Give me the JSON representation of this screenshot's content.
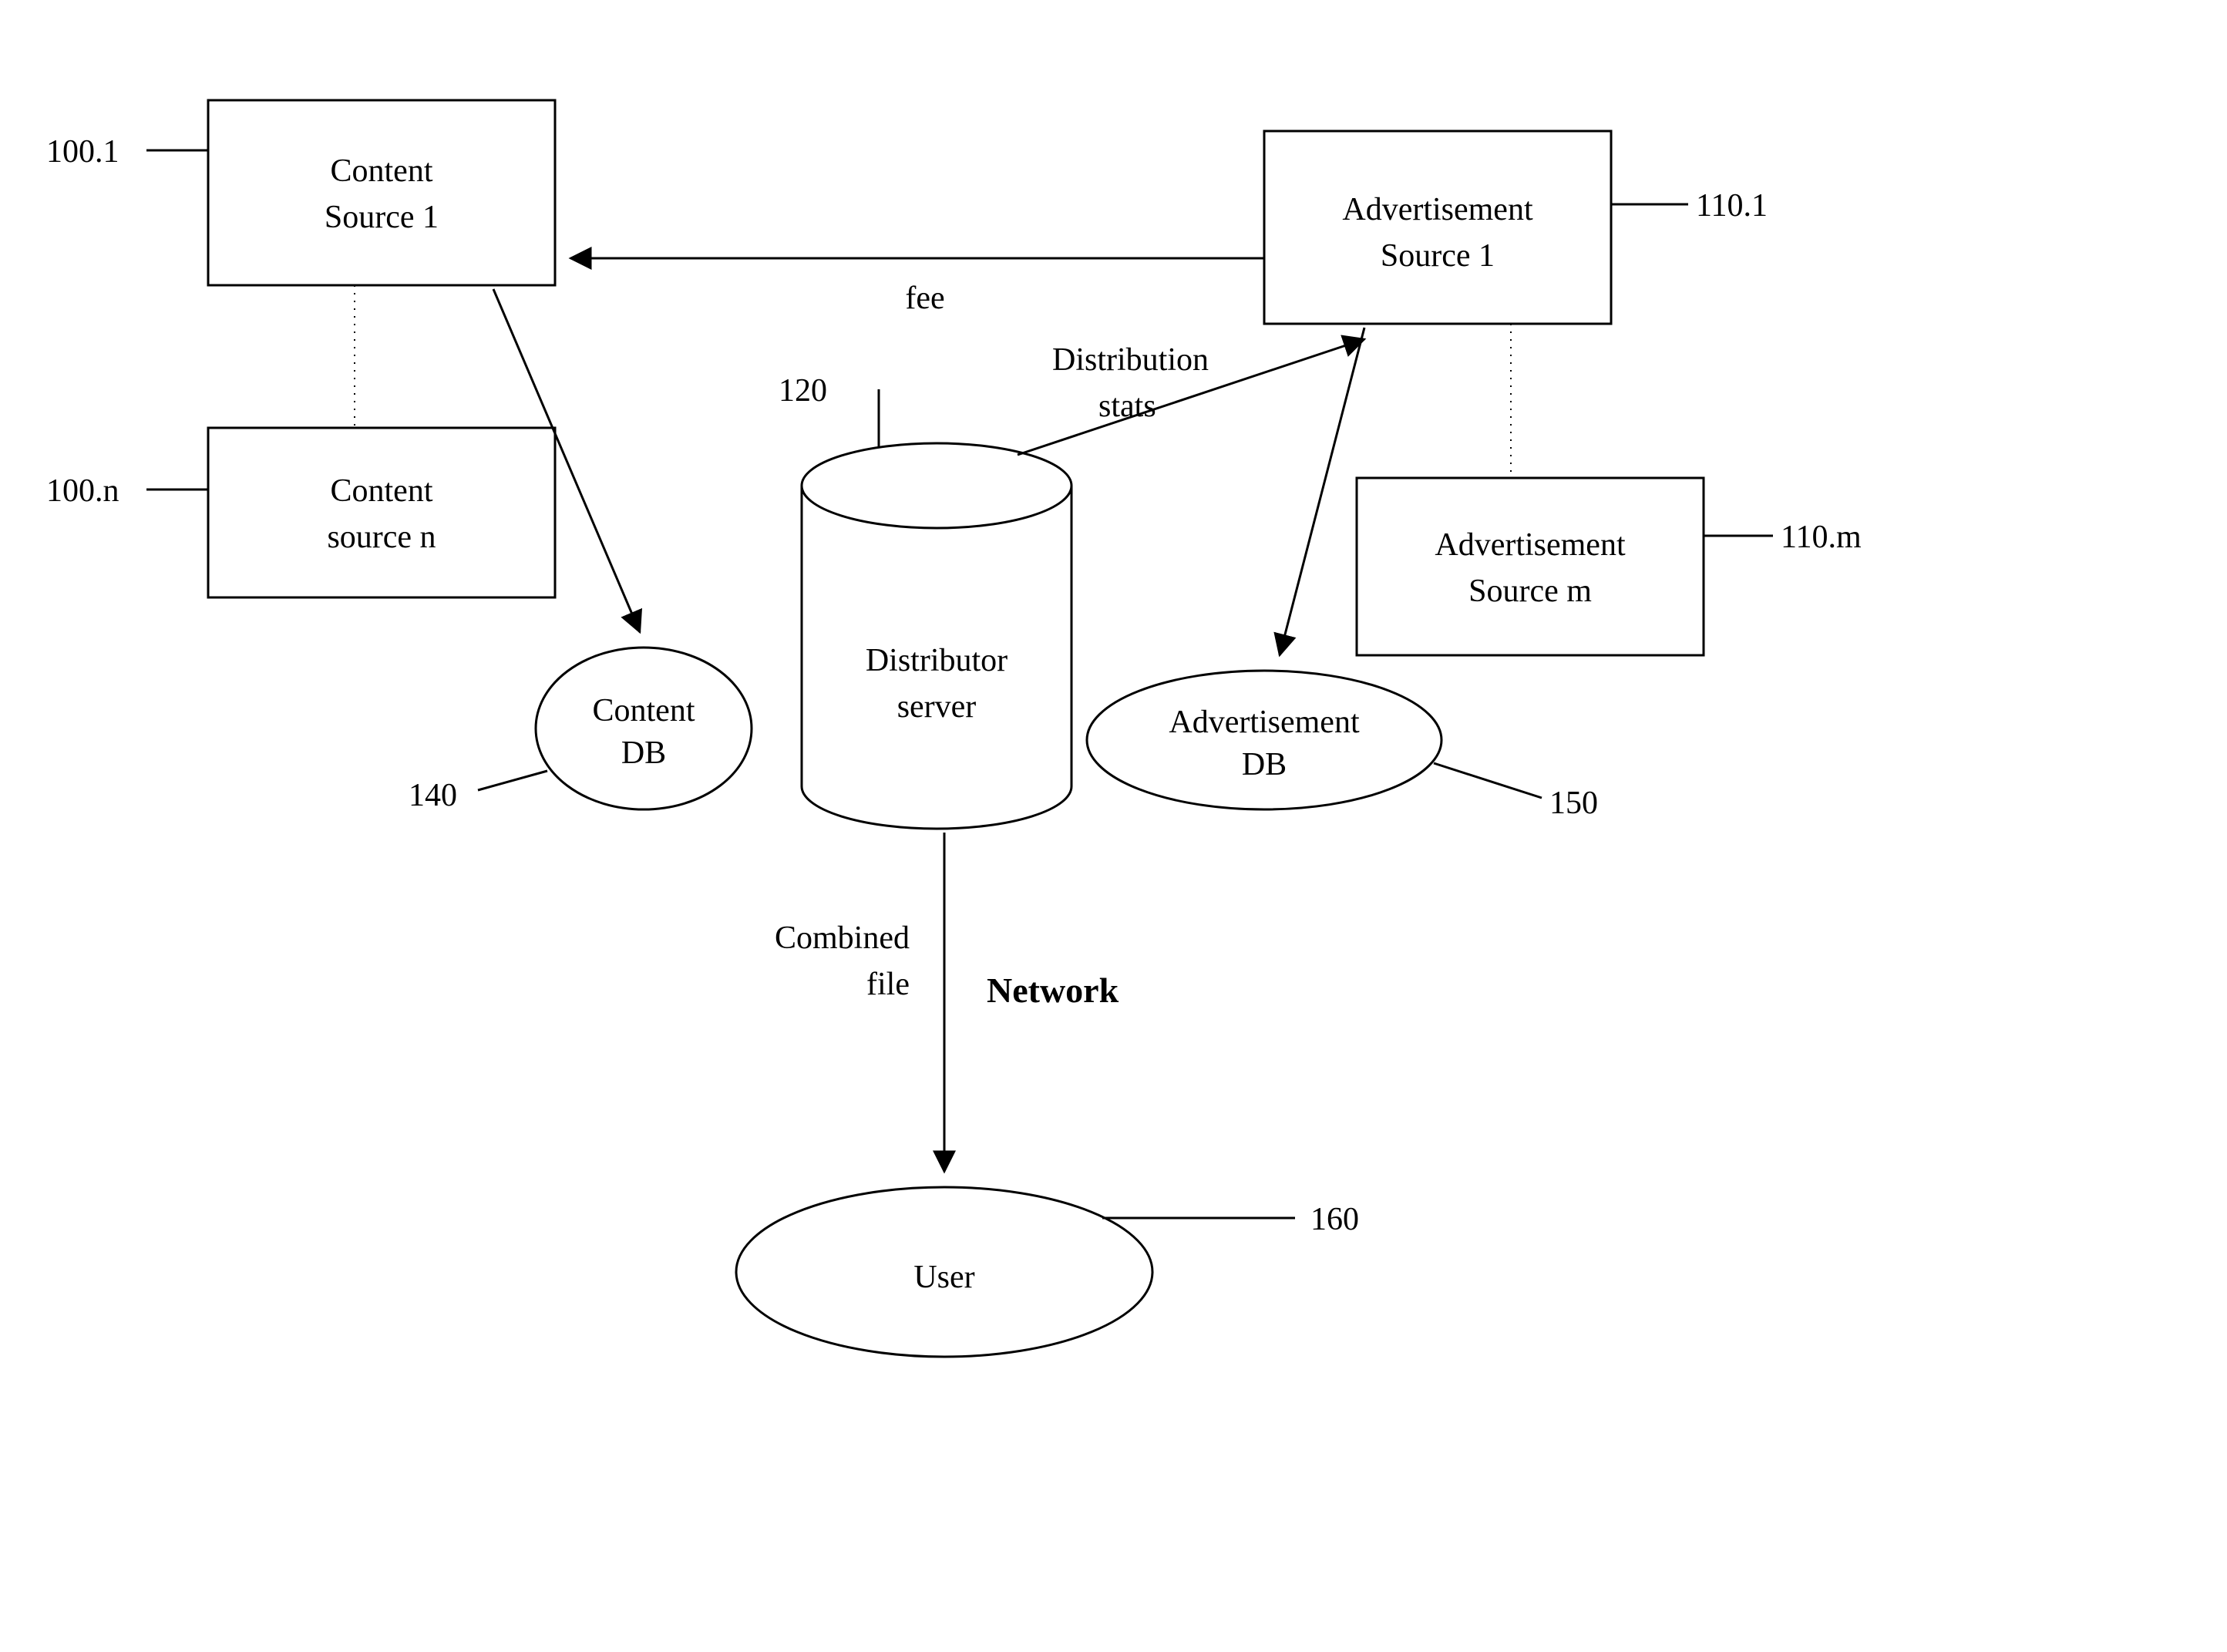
{
  "nodes": {
    "content_source_1": {
      "line1": "Content",
      "line2": "Source 1",
      "ref": "100.1"
    },
    "content_source_n": {
      "line1": "Content",
      "line2": "source n",
      "ref": "100.n"
    },
    "ad_source_1": {
      "line1": "Advertisement",
      "line2": "Source 1",
      "ref": "110.1"
    },
    "ad_source_m": {
      "line1": "Advertisement",
      "line2": "Source m",
      "ref": "110.m"
    },
    "distributor": {
      "line1": "Distributor",
      "line2": "server",
      "ref": "120"
    },
    "content_db": {
      "line1": "Content",
      "line2": "DB",
      "ref": "140"
    },
    "ad_db": {
      "line1": "Advertisement",
      "line2": "DB",
      "ref": "150"
    },
    "user": {
      "line1": "User",
      "ref": "160"
    }
  },
  "edges": {
    "fee": "fee",
    "dist_stats": {
      "line1": "Distribution",
      "line2": "stats"
    },
    "combined_file": {
      "line1": "Combined",
      "line2": "file"
    },
    "network": "Network"
  }
}
